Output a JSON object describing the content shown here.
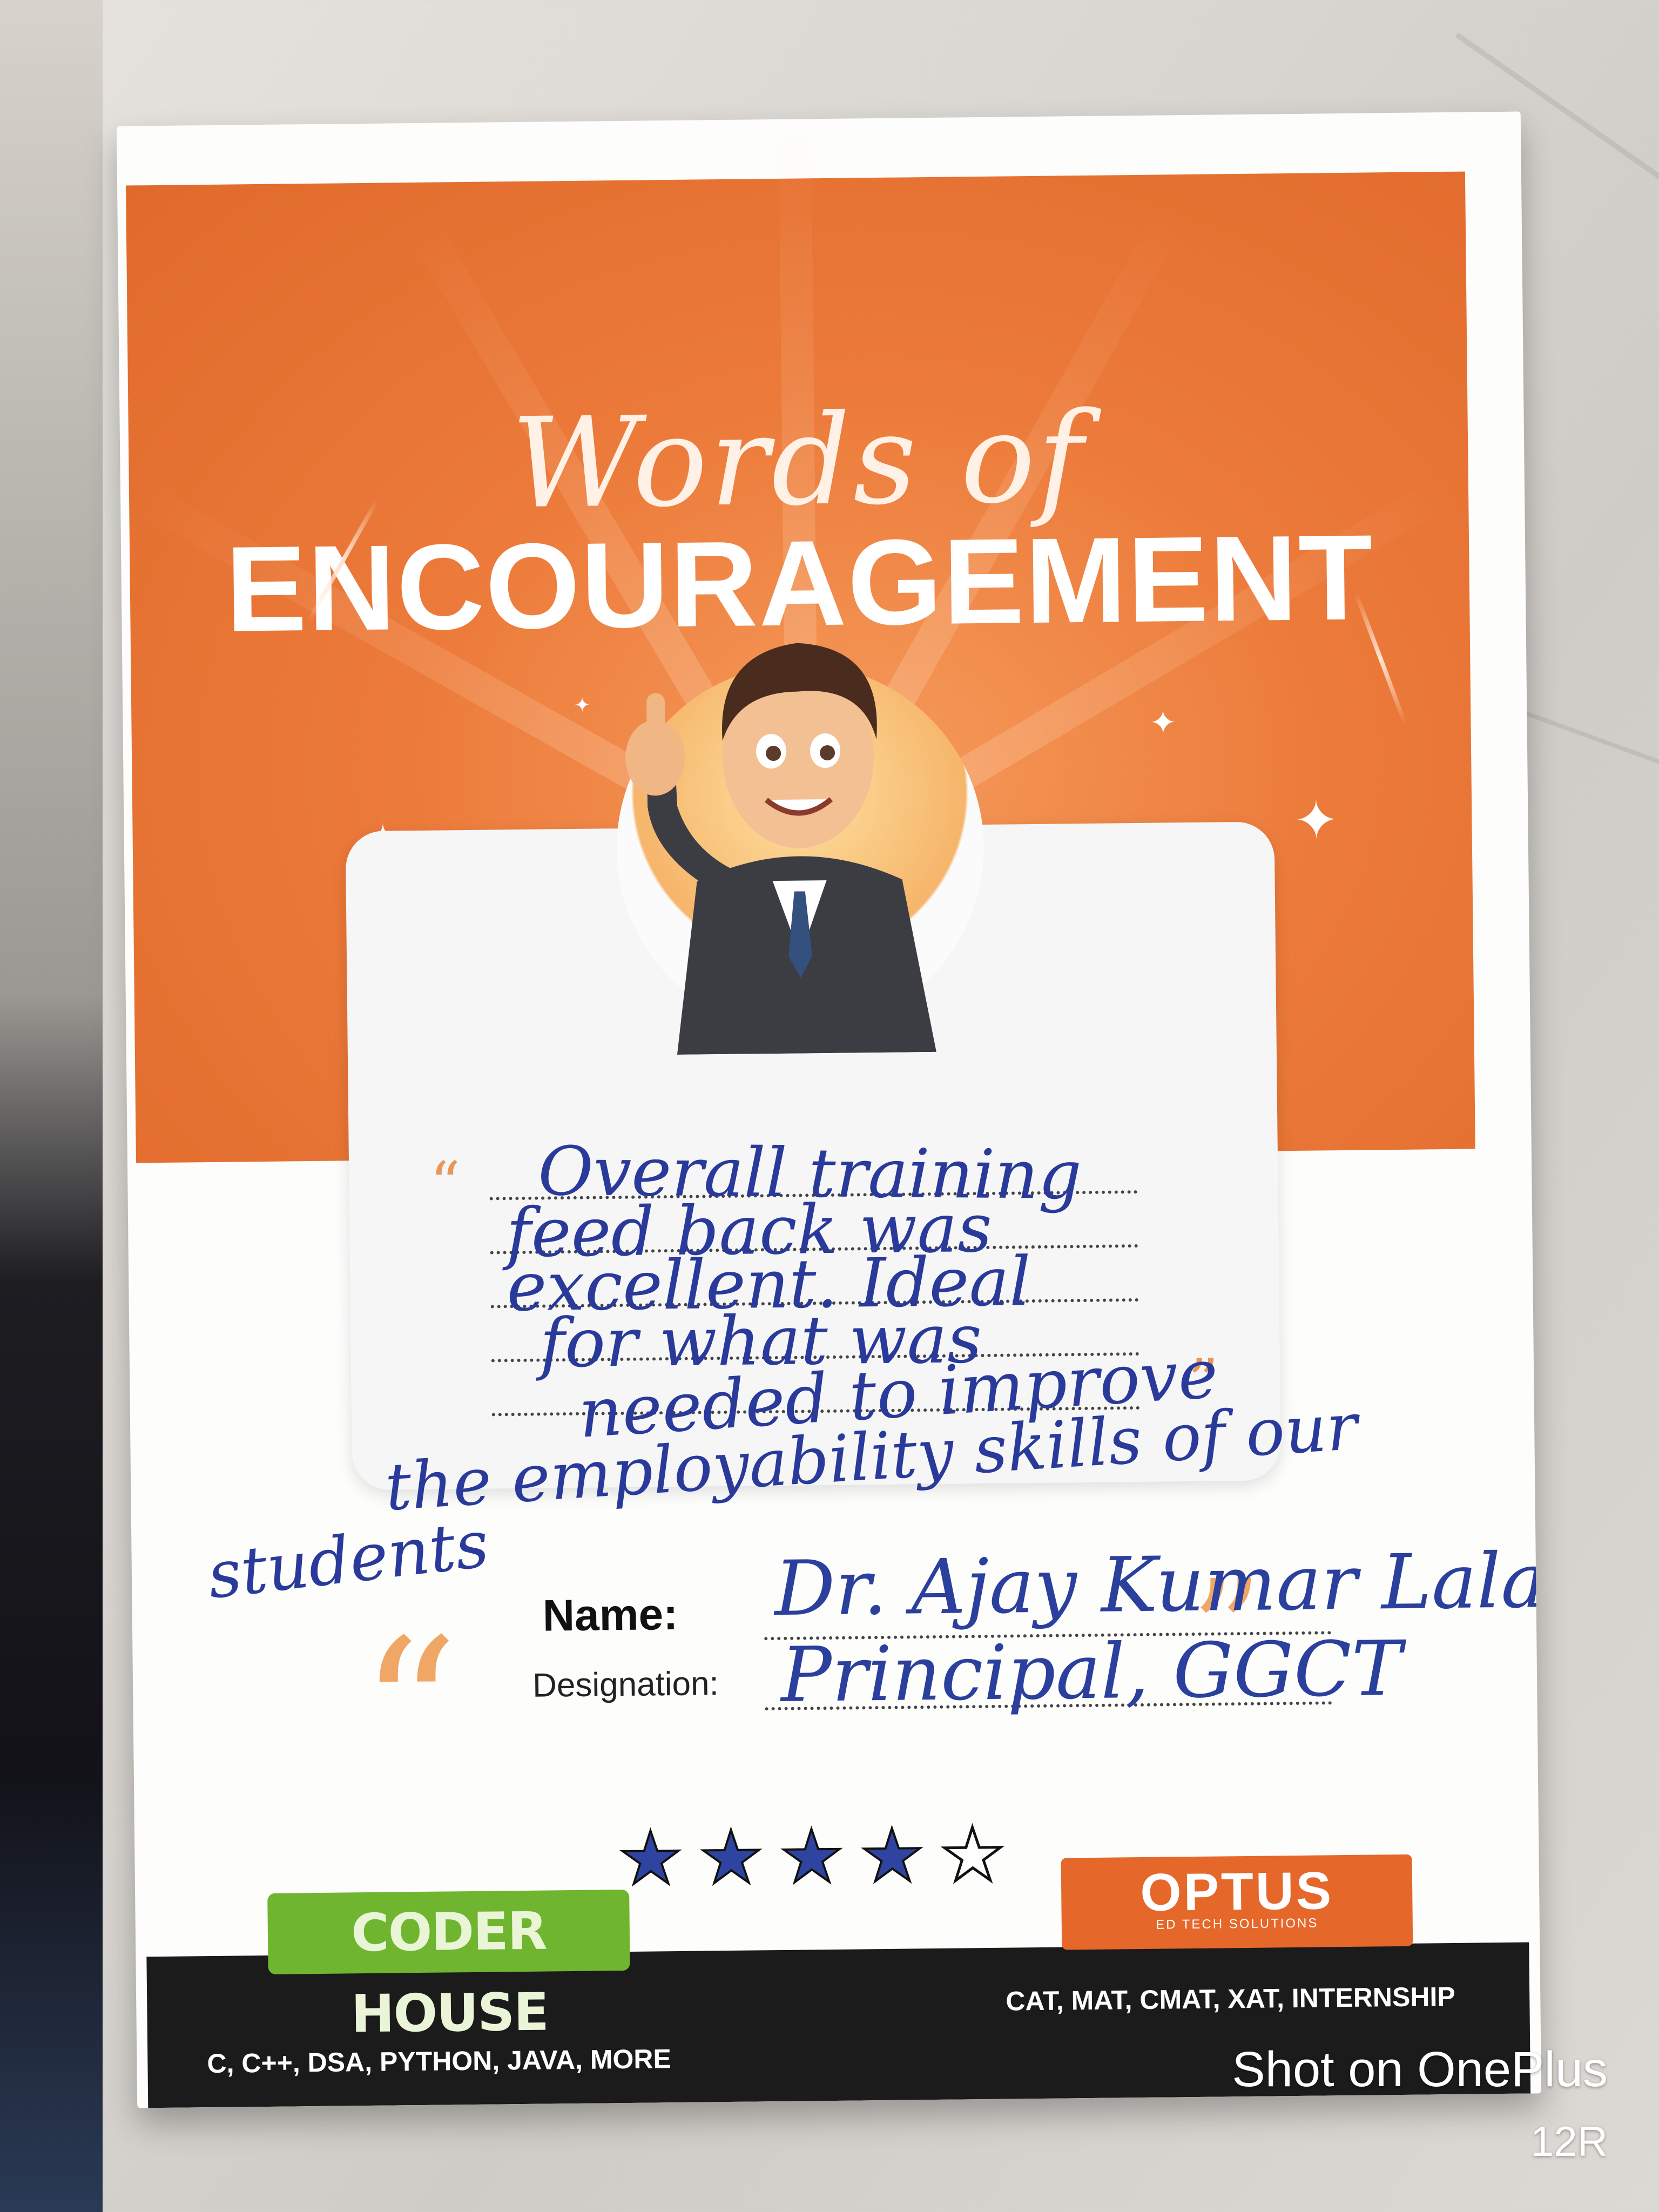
{
  "card": {
    "title_script": "Words of",
    "title_main": "ENCOURAGEMENT",
    "feedback_lines": [
      "Overall training",
      "feed back was",
      "excellent. Ideal",
      "for what was",
      "needed to improve",
      "the employability skills of our",
      "students"
    ],
    "name_label": "Name:",
    "name_value": "Dr. Ajay Kumar Lala",
    "designation_label": "Designation:",
    "designation_value": "Principal, GGCT",
    "rating": {
      "value": 4,
      "max": 5,
      "fill_color": "#2f44a0"
    }
  },
  "footer": {
    "left_brand": "CODER HOUSE",
    "left_tagline": "C, C++, DSA, PYTHON, JAVA, MORE",
    "right_brand": "OPTUS",
    "right_brand_sub": "ED TECH SOLUTIONS",
    "right_tagline": "CAT, MAT, CMAT, XAT, INTERNSHIP"
  },
  "watermark": {
    "line1": "Shot on OnePlus",
    "line2": "12R"
  },
  "colors": {
    "banner": "#e9763a",
    "coder_green": "#6fb52f",
    "optus_orange": "#e5672a",
    "ink_blue": "#2a3a9a"
  }
}
